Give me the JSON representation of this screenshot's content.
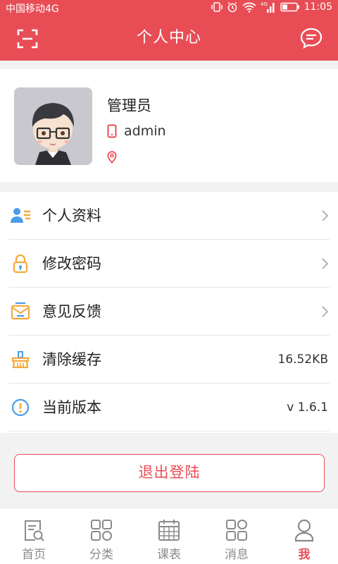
{
  "status_bar": {
    "carrier": "中国移动4G",
    "network": "4G",
    "time": "11:05"
  },
  "header": {
    "title": "个人中心",
    "left_icon": "scan-icon",
    "right_icon": "message-icon"
  },
  "profile": {
    "name": "管理员",
    "username": "admin",
    "location": ""
  },
  "menu": [
    {
      "label": "个人资料",
      "icon": "profile-icon",
      "value": "",
      "chevron": true
    },
    {
      "label": "修改密码",
      "icon": "lock-icon",
      "value": "",
      "chevron": true
    },
    {
      "label": "意见反馈",
      "icon": "feedback-icon",
      "value": "",
      "chevron": true
    },
    {
      "label": "清除缓存",
      "icon": "clear-cache-icon",
      "value": "16.52KB",
      "chevron": false
    },
    {
      "label": "当前版本",
      "icon": "info-icon",
      "value": "v 1.6.1",
      "chevron": false
    }
  ],
  "logout_label": "退出登陆",
  "bottom_nav": [
    {
      "label": "首页",
      "icon": "home-icon",
      "active": false
    },
    {
      "label": "分类",
      "icon": "category-icon",
      "active": false
    },
    {
      "label": "课表",
      "icon": "calendar-icon",
      "active": false
    },
    {
      "label": "消息",
      "icon": "message-icon",
      "active": false
    },
    {
      "label": "我",
      "icon": "user-icon",
      "active": true
    }
  ],
  "colors": {
    "primary": "#e84d55",
    "background": "#f2f2f2",
    "inactive_tab": "#8a8a8a"
  }
}
